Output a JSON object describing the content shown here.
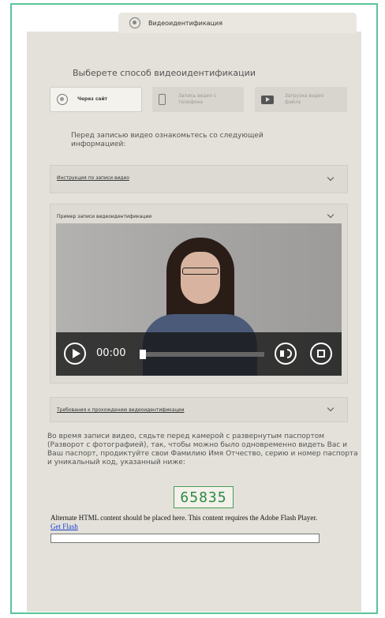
{
  "tab": {
    "label": "Видеоидентификация",
    "icon": "webcam-icon"
  },
  "choose_title": "Выберете способ видеоидентификации",
  "methods": [
    {
      "label": "Через сайт",
      "icon": "webcam-icon",
      "active": true
    },
    {
      "label": "Запись видео с телефона",
      "icon": "phone-icon",
      "active": false
    },
    {
      "label": "Загрузка видео файла",
      "icon": "video-file-icon",
      "active": false
    }
  ],
  "intro_text": "Перед записью видео ознакомьтесь со следующей информацией:",
  "accordions": [
    {
      "title": "Инструкция по записи видео"
    },
    {
      "title": "Пример записи видеоидентификации"
    },
    {
      "title": "Требования к прохождению видеоидентификации"
    }
  ],
  "video": {
    "time": "00:00",
    "progress": 0.0
  },
  "instructions": "Во время записи видео, сядьте перед камерой с развернутым паспортом (Разворот с фотографией), так, чтобы можно было одновременно видеть Вас и Ваш паспорт, продиктуйте свои Фамилию Имя Отчество, серию и номер паспорта и уникальный код, указанный ниже:",
  "code": "65835",
  "flash": {
    "text": "Alternate HTML content should be placed here. This content requires the Adobe Flash Player.",
    "link": "Get Flash"
  },
  "colors": {
    "accent": "#5bc49a",
    "panel": "#e3e1d9",
    "code": "#2d8a45",
    "link": "#1a3fd0"
  }
}
